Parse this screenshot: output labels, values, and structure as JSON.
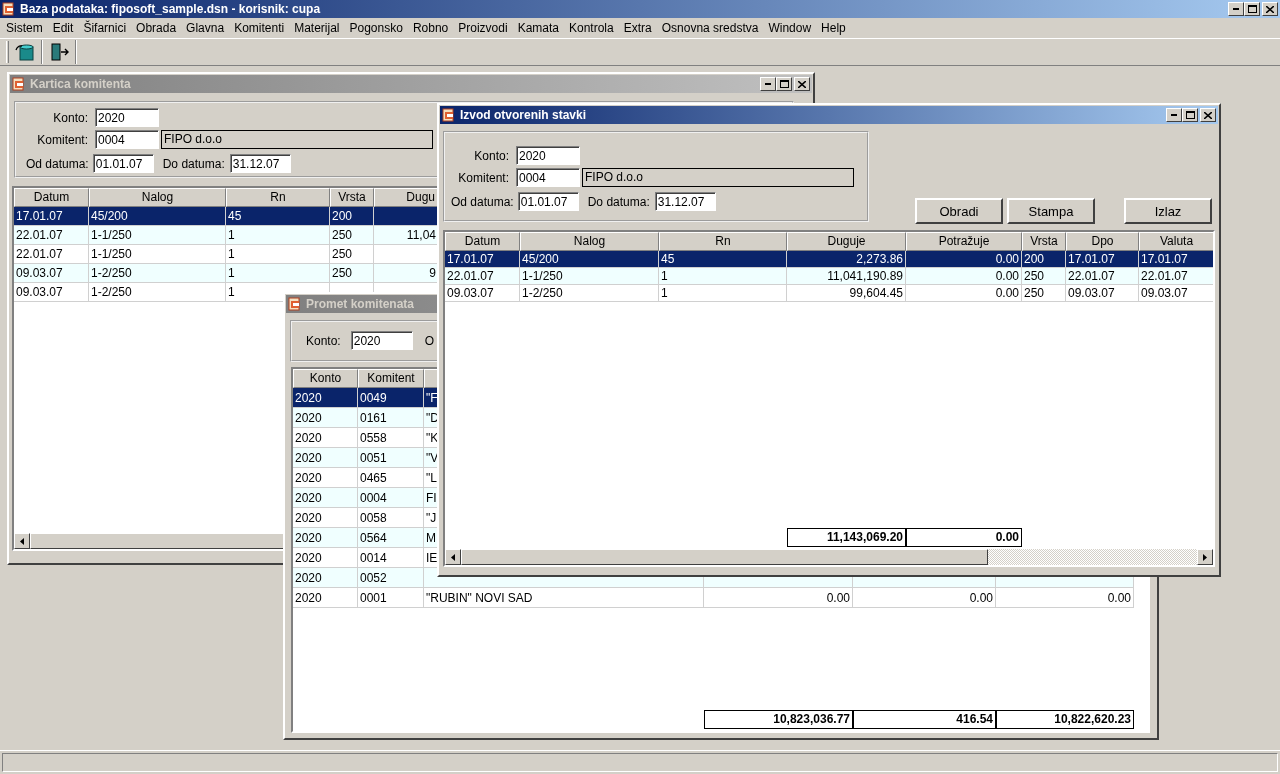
{
  "app": {
    "title": "Baza podataka: fiposoft_sample.dsn  -  korisnik: cupa",
    "menu": [
      "Sistem",
      "Edit",
      "Šifarnici",
      "Obrada",
      "Glavna",
      "Komitenti",
      "Materijal",
      "Pogonsko",
      "Robno",
      "Proizvodi",
      "Kamata",
      "Kontrola",
      "Extra",
      "Osnovna sredstva",
      "Window",
      "Help"
    ]
  },
  "windows": {
    "kartica_komitenta": {
      "title": "Kartica komitenta",
      "active": false,
      "form": {
        "konto": {
          "label": "Konto:",
          "value": "2020"
        },
        "komitent": {
          "label": "Komitent:",
          "value": "0004",
          "name": "FIPO d.o.o"
        },
        "od_datuma": {
          "label": "Od datuma:",
          "value": "01.01.07"
        },
        "do_datuma": {
          "label": "Do datuma:",
          "value": "31.12.07"
        }
      },
      "grid": {
        "columns": [
          "Datum",
          "Nalog",
          "Rn",
          "Vrsta",
          "Dugu"
        ],
        "rows": [
          {
            "cells": [
              "17.01.07",
              "45/200",
              "45",
              "200"
            ],
            "selected": true
          },
          {
            "cells": [
              "22.01.07",
              "1-1/250",
              "1",
              "250",
              "11,04"
            ],
            "selected": false
          },
          {
            "cells": [
              "22.01.07",
              "1-1/250",
              "1",
              "250"
            ],
            "selected": false
          },
          {
            "cells": [
              "09.03.07",
              "1-2/250",
              "1",
              "250",
              "9"
            ],
            "selected": false
          },
          {
            "cells": [
              "09.03.07",
              "1-2/250",
              "1"
            ],
            "selected": false
          }
        ]
      }
    },
    "promet_komitenata": {
      "title": "Promet komitenata",
      "active": false,
      "form": {
        "konto": {
          "label": "Konto:",
          "value": "2020"
        },
        "label_2": "O"
      },
      "grid": {
        "columns": [
          "Konto",
          "Komitent"
        ],
        "rows": [
          {
            "cells": [
              "2020",
              "0049",
              "\"F"
            ],
            "selected": true
          },
          {
            "cells": [
              "2020",
              "0161",
              "\"D"
            ],
            "selected": false
          },
          {
            "cells": [
              "2020",
              "0558",
              "\"K"
            ],
            "selected": false
          },
          {
            "cells": [
              "2020",
              "0051",
              "\"V"
            ],
            "selected": false
          },
          {
            "cells": [
              "2020",
              "0465",
              "\"L"
            ],
            "selected": false
          },
          {
            "cells": [
              "2020",
              "0004",
              "FI"
            ],
            "selected": false
          },
          {
            "cells": [
              "2020",
              "0058",
              "\"J"
            ],
            "selected": false
          },
          {
            "cells": [
              "2020",
              "0564",
              "M"
            ],
            "selected": false
          },
          {
            "cells": [
              "2020",
              "0014",
              "IE"
            ],
            "selected": false
          },
          {
            "cells": [
              "2020",
              "0052"
            ],
            "selected": false
          },
          {
            "cells": [
              "2020",
              "0001",
              "\"RUBIN\" NOVI SAD",
              "0.00",
              "0.00",
              "0.00"
            ],
            "selected": false
          }
        ],
        "totals": [
          "10,823,036.77",
          "416.54",
          "10,822,620.23"
        ]
      }
    },
    "izvod_otvorenih_stavki": {
      "title": "Izvod otvorenih stavki",
      "active": true,
      "form": {
        "konto": {
          "label": "Konto:",
          "value": "2020"
        },
        "komitent": {
          "label": "Komitent:",
          "value": "0004",
          "name": "FIPO d.o.o"
        },
        "od_datuma": {
          "label": "Od datuma:",
          "value": "01.01.07"
        },
        "do_datuma": {
          "label": "Do datuma:",
          "value": "31.12.07"
        }
      },
      "buttons": [
        "Obradi",
        "Stampa",
        "Izlaz"
      ],
      "grid": {
        "columns": [
          "Datum",
          "Nalog",
          "Rn",
          "Duguje",
          "Potražuje",
          "Vrsta",
          "Dpo",
          "Valuta"
        ],
        "rows": [
          {
            "cells": [
              "17.01.07",
              "45/200",
              "45",
              "2,273.86",
              "0.00",
              "200",
              "17.01.07",
              "17.01.07"
            ],
            "selected": true
          },
          {
            "cells": [
              "22.01.07",
              "1-1/250",
              "1",
              "11,041,190.89",
              "0.00",
              "250",
              "22.01.07",
              "22.01.07"
            ],
            "selected": false
          },
          {
            "cells": [
              "09.03.07",
              "1-2/250",
              "1",
              "99,604.45",
              "0.00",
              "250",
              "09.03.07",
              "09.03.07"
            ],
            "selected": false
          }
        ],
        "totals": [
          "11,143,069.20",
          "0.00"
        ]
      }
    }
  }
}
